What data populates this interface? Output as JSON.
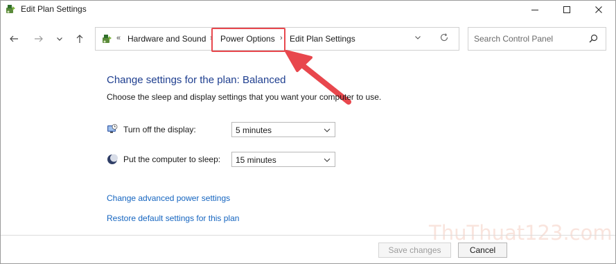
{
  "window": {
    "title": "Edit Plan Settings",
    "icon": "power-options-icon"
  },
  "nav": {
    "back_icon": "arrow-left-icon",
    "forward_icon": "arrow-right-icon",
    "recent_icon": "chevron-down-icon",
    "up_icon": "arrow-up-icon"
  },
  "address": {
    "chevron": "«",
    "crumbs": [
      "Hardware and Sound",
      "Power Options",
      "Edit Plan Settings"
    ],
    "separator": "›"
  },
  "search": {
    "placeholder": "Search Control Panel"
  },
  "main": {
    "heading": "Change settings for the plan: Balanced",
    "description": "Choose the sleep and display settings that you want your computer to use.",
    "settings": [
      {
        "label": "Turn off the display:",
        "value": "5 minutes",
        "icon": "monitor-clock-icon"
      },
      {
        "label": "Put the computer to sleep:",
        "value": "15 minutes",
        "icon": "moon-icon"
      }
    ],
    "links": [
      "Change advanced power settings",
      "Restore default settings for this plan"
    ]
  },
  "footer": {
    "save_label": "Save changes",
    "cancel_label": "Cancel"
  },
  "annotation": {
    "highlight_color": "#e8474d"
  },
  "watermark": "ThuThuat123.com"
}
